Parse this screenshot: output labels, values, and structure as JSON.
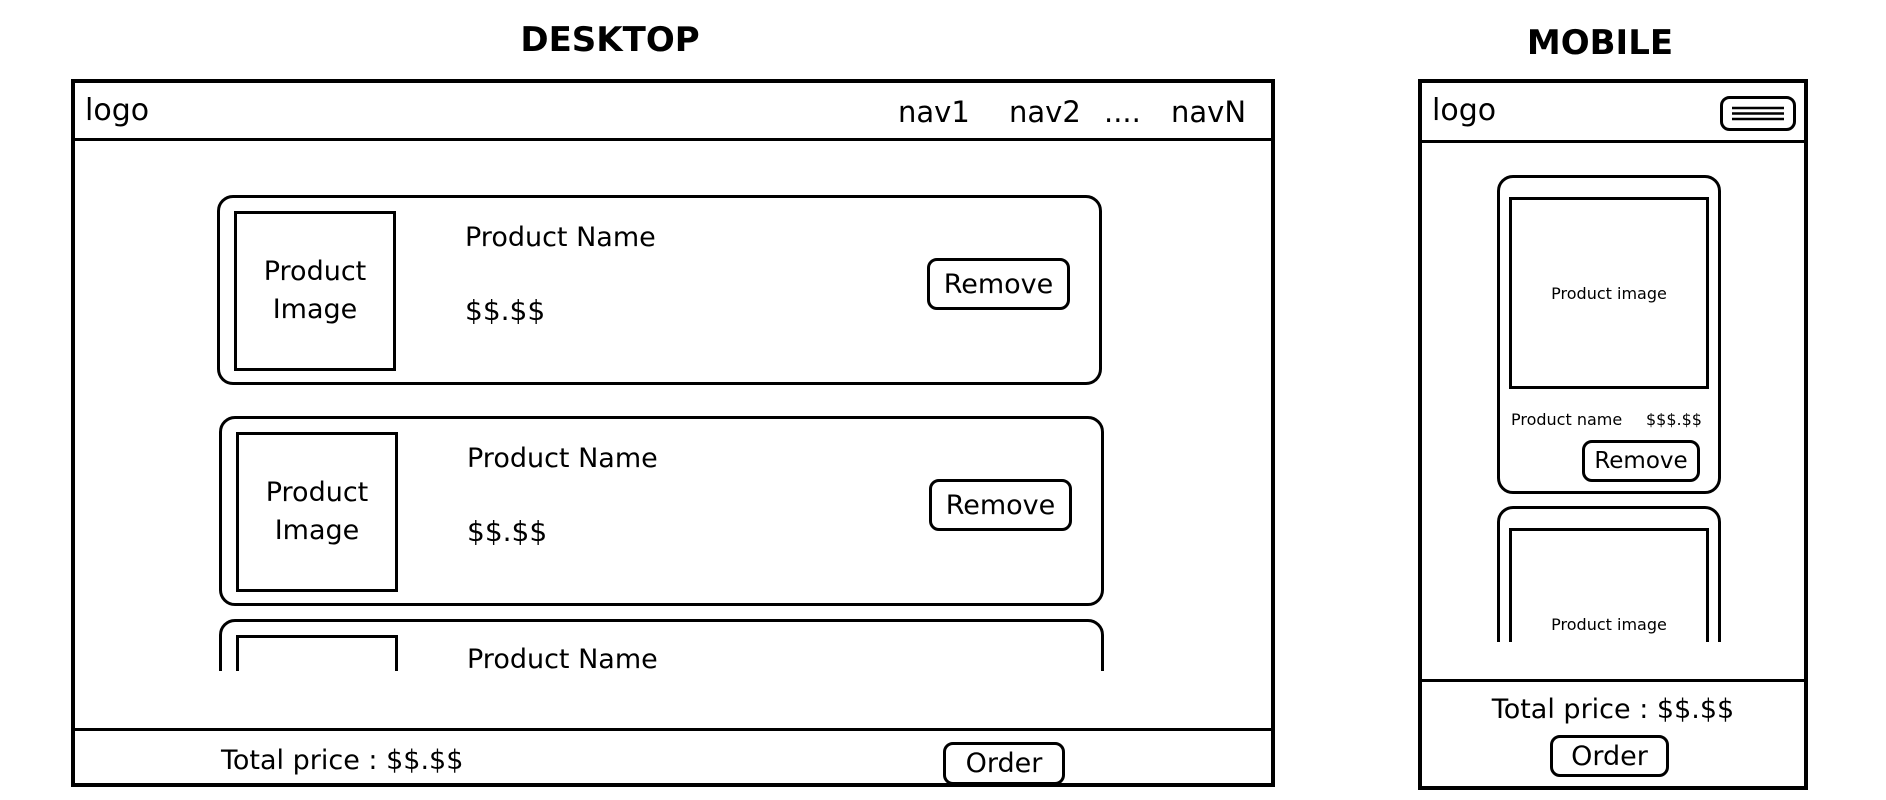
{
  "desktop": {
    "heading": "DESKTOP",
    "logo": "logo",
    "nav": [
      "nav1",
      "nav2",
      "....",
      "navN"
    ],
    "products": [
      {
        "image": "Product\nImage",
        "name": "Product Name",
        "price": "$$.$$",
        "remove": "Remove"
      },
      {
        "image": "Product\nImage",
        "name": "Product Name",
        "price": "$$.$$",
        "remove": "Remove"
      },
      {
        "name": "Product Name"
      }
    ],
    "total": "Total price : $$.$$",
    "order": "Order"
  },
  "mobile": {
    "heading": "MOBILE",
    "logo": "logo",
    "menu_icon": "hamburger-menu-icon",
    "products": [
      {
        "image": "Product image",
        "name": "Product name",
        "price": "$$$.$$",
        "remove": "Remove"
      },
      {
        "image": "Product image"
      }
    ],
    "total": "Total price : $$.$$",
    "order": "Order"
  }
}
